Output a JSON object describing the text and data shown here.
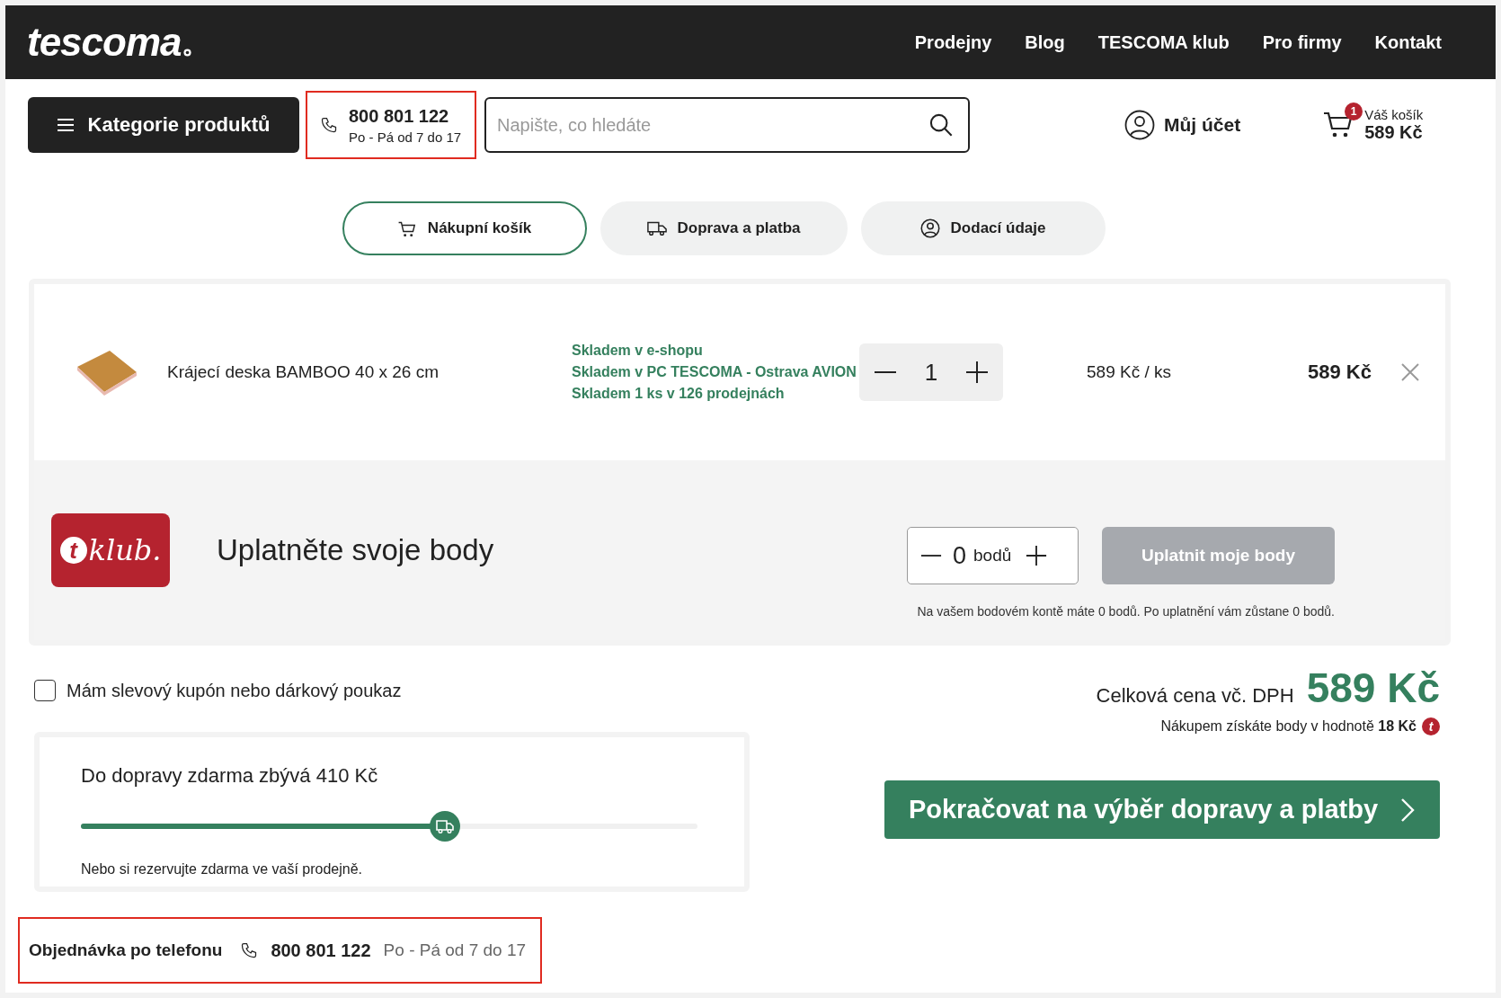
{
  "header": {
    "logo": "tescoma",
    "nav": [
      "Prodejny",
      "Blog",
      "TESCOMA klub",
      "Pro firmy",
      "Kontakt"
    ]
  },
  "toolbar": {
    "categories_button": "Kategorie produktů",
    "phone": {
      "number": "800 801 122",
      "hours": "Po - Pá od 7 do 17",
      "highlighted": true
    },
    "search": {
      "placeholder": "Napište, co hledáte"
    },
    "account": "Můj účet",
    "cart": {
      "badge": "1",
      "label": "Váš košík",
      "total": "589 Kč"
    }
  },
  "steps": [
    {
      "label": "Nákupní košík",
      "kind": "cart",
      "selected": true
    },
    {
      "label": "Doprava a platba",
      "kind": "truck",
      "selected": false
    },
    {
      "label": "Dodací údaje",
      "kind": "user",
      "selected": false
    }
  ],
  "items": [
    {
      "name": "Krájecí deska BAMBOO 40 x 26 cm",
      "stock": [
        "Skladem v e-shopu",
        "Skladem v PC TESCOMA - Ostrava AVION",
        "Skladem 1 ks v 126 prodejnách"
      ],
      "quantity": "1",
      "unit_price": "589 Kč / ks",
      "total": "589 Kč"
    }
  ],
  "club": {
    "logo_letter": "t",
    "logo_text": "klub.",
    "title": "Uplatněte svoje body",
    "points": "0",
    "points_unit": "bodů",
    "apply_button": "Uplatnit moje body",
    "apply_disabled": true,
    "note": "Na vašem bodovém kontě máte 0 bodů. Po uplatnění vám zůstane 0 bodů."
  },
  "coupon": {
    "label": "Mám slevový kupón nebo dárkový poukaz",
    "checked": false
  },
  "shipping": {
    "title": "Do dopravy zdarma zbývá 410 Kč",
    "level": 0.59,
    "note": "Nebo si rezervujte zdarma ve vaší prodejně."
  },
  "summary": {
    "total_label": "Celková cena vč. DPH",
    "total": "589 Kč",
    "points_text": "Nákupem získáte body v hodnotě **18 Kč**",
    "points_letter": "t",
    "continue_button": "Pokračovat na výběr dopravy a platby"
  },
  "phone_order": {
    "label": "Objednávka po telefonu",
    "number": "800 801 122",
    "hours": "Po - Pá od 7 do 17",
    "highlighted": true
  }
}
